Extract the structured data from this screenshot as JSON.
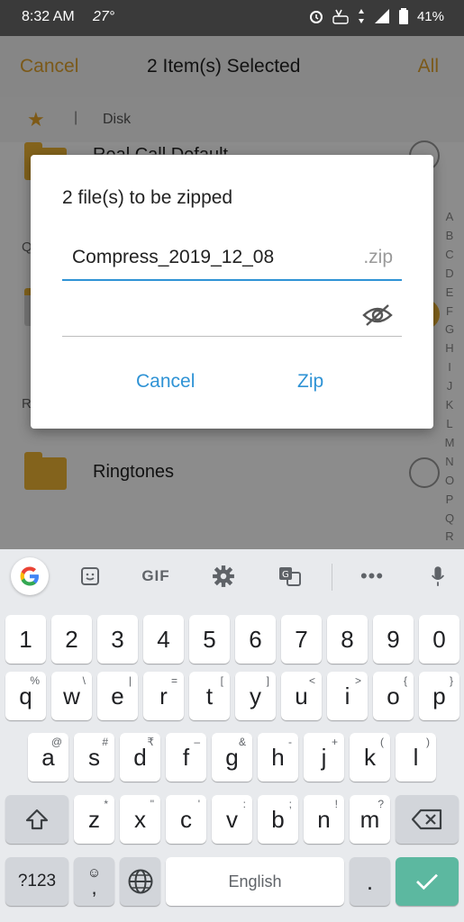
{
  "status_bar": {
    "time": "8:32 AM",
    "temp": "27°",
    "battery": "41%"
  },
  "app_bar": {
    "cancel": "Cancel",
    "title": "2 Item(s) Selected",
    "all": "All"
  },
  "breadcrumb": {
    "separator": "|",
    "location": "Disk"
  },
  "list": {
    "partial_item": "Real Call Default",
    "section_q": "Q",
    "section_r": "R",
    "ringtones": "Ringtones"
  },
  "alphabet": [
    "A",
    "B",
    "C",
    "D",
    "E",
    "F",
    "G",
    "H",
    "I",
    "J",
    "K",
    "L",
    "M",
    "N",
    "O",
    "P",
    "Q",
    "R"
  ],
  "dialog": {
    "title": "2 file(s) to be zipped",
    "filename": "Compress_2019_12_08",
    "extension": ".zip",
    "cancel": "Cancel",
    "zip": "Zip"
  },
  "keyboard": {
    "toolbar": {
      "gif": "GIF"
    },
    "row1": [
      "1",
      "2",
      "3",
      "4",
      "5",
      "6",
      "7",
      "8",
      "9",
      "0"
    ],
    "row2": {
      "keys": [
        "q",
        "w",
        "e",
        "r",
        "t",
        "y",
        "u",
        "i",
        "o",
        "p"
      ],
      "hints": [
        "%",
        "\\",
        "|",
        "=",
        "[",
        "]",
        "<",
        ">",
        "{",
        "}"
      ]
    },
    "row3": {
      "keys": [
        "a",
        "s",
        "d",
        "f",
        "g",
        "h",
        "j",
        "k",
        "l"
      ],
      "hints": [
        "@",
        "#",
        "₹",
        "–",
        "&",
        "-",
        "+",
        "(",
        ")"
      ]
    },
    "row4": {
      "keys": [
        "z",
        "x",
        "c",
        "v",
        "b",
        "n",
        "m"
      ],
      "hints": [
        "*",
        "\"",
        "'",
        ":",
        ";",
        "!",
        "?"
      ]
    },
    "symbols_key": "?123",
    "emoji_comma": ",",
    "space_label": "English",
    "period": "."
  },
  "colors": {
    "accent_blue": "#2f93d5",
    "app_orange": "#e0a32e",
    "enter_green": "#5cb8a0"
  }
}
